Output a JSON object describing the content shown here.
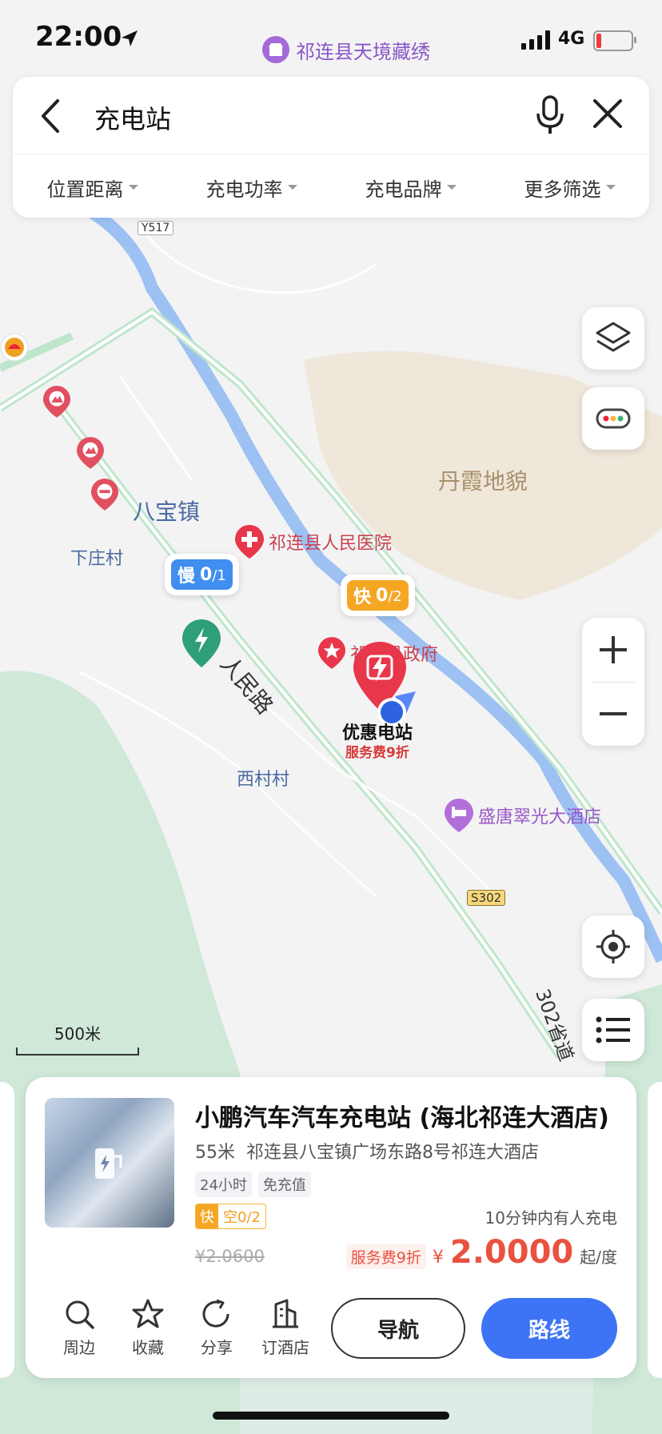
{
  "status_bar": {
    "time": "22:00",
    "network": "4G",
    "banner": "祁连县天境藏绣"
  },
  "search": {
    "query": "充电站",
    "filters": [
      "位置距离",
      "充电功率",
      "充电品牌",
      "更多筛选"
    ]
  },
  "map": {
    "labels": {
      "road_y517": "Y517",
      "road_s302": "S302",
      "danxia": "丹霞地貌",
      "babao": "八宝镇",
      "xiazhuang": "下庄村",
      "hospital": "祁连县人民医院",
      "government": "祁连县政府",
      "renmin_road": "人民路",
      "xicun": "西村村",
      "hotel": "盛唐翠光大酒店",
      "s302_road_name": "302省道"
    },
    "selected_station": {
      "name": "优惠电站",
      "promo": "服务费9折"
    },
    "bubble_slow": {
      "type": "慢",
      "available": "0",
      "total": "/1"
    },
    "bubble_fast": {
      "type": "快",
      "available": "0",
      "total": "/2"
    },
    "scale": "500米"
  },
  "station_card": {
    "title": "小鹏汽车汽车充电站 (海北祁连大酒店)",
    "distance": "55米",
    "address": "祁连县八宝镇广场东路8号祁连大酒店",
    "tags": [
      "24小时",
      "免充值"
    ],
    "fast_label": "快",
    "fast_status": "空0/2",
    "eta": "10分钟内有人充电",
    "original_price": "¥2.0600",
    "promo": "服务费9折",
    "currency": "¥",
    "price": "2.0000",
    "unit": "起/度",
    "actions": [
      {
        "label": "周边",
        "icon": "search-icon"
      },
      {
        "label": "收藏",
        "icon": "star-icon"
      },
      {
        "label": "分享",
        "icon": "share-icon"
      },
      {
        "label": "订酒店",
        "icon": "hotel-icon"
      }
    ],
    "nav_button": "导航",
    "route_button": "路线"
  },
  "colors": {
    "accent": "#3d73f5",
    "price": "#e8523f",
    "fast": "#f5a623",
    "slow": "#3f8ef0",
    "station_pin": "#e8374a"
  }
}
